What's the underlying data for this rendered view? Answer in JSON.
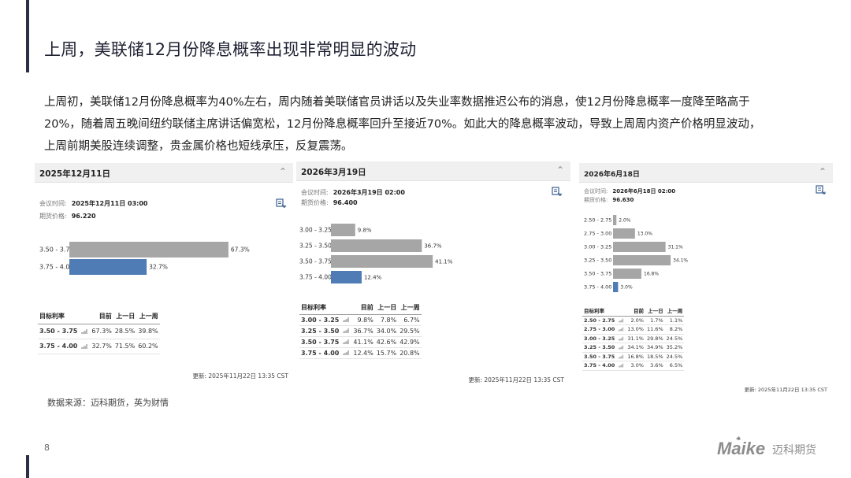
{
  "header": {
    "title": "上周，美联储12月份降息概率出现非常明显的波动"
  },
  "summary": [
    "上周初，美联储12月份降息概率为40%左右，周内随着美联储官员讲话以及失业率数据推迟公布的消息，使12月份降息概率一度降至略高于",
    "20%，随着周五晚间纽约联储主席讲话偏宽松，12月份降息概率回升至接近70%。如此大的降息概率波动，导致上周周内资产价格明显波动，",
    "上周前期美股连续调整，贵金属价格也短线承压，反复震荡。"
  ],
  "colors": {
    "bar_gray": "#a6a6a6",
    "bar_blue": "#4f7cb4",
    "panel_header": "#f0f0f0",
    "accent": "#2a2f45",
    "logo_gray": "#8c8c8c"
  },
  "chart_data": [
    {
      "type": "bar",
      "date": "2025年12月11日",
      "meeting_time_label": "会议时间:",
      "meeting_time": "2025年12月11日 03:00",
      "futures_label": "期货价格:",
      "futures_price": "96.220",
      "categories": [
        "3.50 - 3.75",
        "3.75 - 4.00"
      ],
      "values": [
        67.3,
        32.7
      ],
      "highlight": "3.75 - 4.00",
      "table_headers": [
        "目标利率",
        "目前",
        "上一日",
        "上一周"
      ],
      "rows": [
        [
          "3.50 - 3.75",
          "67.3%",
          "28.5%",
          "39.8%"
        ],
        [
          "3.75 - 4.00",
          "32.7%",
          "71.5%",
          "60.2%"
        ]
      ],
      "updated": "更新: 2025年11月22日 13:35 CST"
    },
    {
      "type": "bar",
      "date": "2026年3月19日",
      "meeting_time_label": "会议时间:",
      "meeting_time": "2026年3月19日 02:00",
      "futures_label": "期货价格:",
      "futures_price": "96.400",
      "categories": [
        "3.00 - 3.25",
        "3.25 - 3.50",
        "3.50 - 3.75",
        "3.75 - 4.00"
      ],
      "values": [
        9.8,
        36.7,
        41.1,
        12.4
      ],
      "highlight": "3.75 - 4.00",
      "table_headers": [
        "目标利率",
        "目前",
        "上一日",
        "上一周"
      ],
      "rows": [
        [
          "3.00 - 3.25",
          "9.8%",
          "7.8%",
          "6.7%"
        ],
        [
          "3.25 - 3.50",
          "36.7%",
          "34.0%",
          "29.5%"
        ],
        [
          "3.50 - 3.75",
          "41.1%",
          "42.6%",
          "42.9%"
        ],
        [
          "3.75 - 4.00",
          "12.4%",
          "15.7%",
          "20.8%"
        ]
      ],
      "updated": "更新: 2025年11月22日 13:35 CST"
    },
    {
      "type": "bar",
      "date": "2026年6月18日",
      "meeting_time_label": "会议时间:",
      "meeting_time": "2026年6月18日 02:00",
      "futures_label": "期货价格:",
      "futures_price": "96.630",
      "categories": [
        "2.50 - 2.75",
        "2.75 - 3.00",
        "3.00 - 3.25",
        "3.25 - 3.50",
        "3.50 - 3.75",
        "3.75 - 4.00"
      ],
      "values": [
        2.0,
        13.0,
        31.1,
        34.1,
        16.8,
        3.0
      ],
      "highlight": "3.75 - 4.00",
      "table_headers": [
        "目标利率",
        "目前",
        "上一日",
        "上一周"
      ],
      "rows": [
        [
          "2.50 - 2.75",
          "2.0%",
          "1.7%",
          "1.1%"
        ],
        [
          "2.75 - 3.00",
          "13.0%",
          "11.6%",
          "8.2%"
        ],
        [
          "3.00 - 3.25",
          "31.1%",
          "29.8%",
          "24.5%"
        ],
        [
          "3.25 - 3.50",
          "34.1%",
          "34.9%",
          "35.2%"
        ],
        [
          "3.50 - 3.75",
          "16.8%",
          "18.5%",
          "24.5%"
        ],
        [
          "3.75 - 4.00",
          "3.0%",
          "3.6%",
          "6.5%"
        ]
      ],
      "updated": "更新: 2025年11月22日 13:35 CST"
    }
  ],
  "footer": {
    "source": "数据来源：迈科期货，英为财情",
    "page_number": "8",
    "logo_latin": "Maike",
    "logo_cn": "迈科期货"
  }
}
